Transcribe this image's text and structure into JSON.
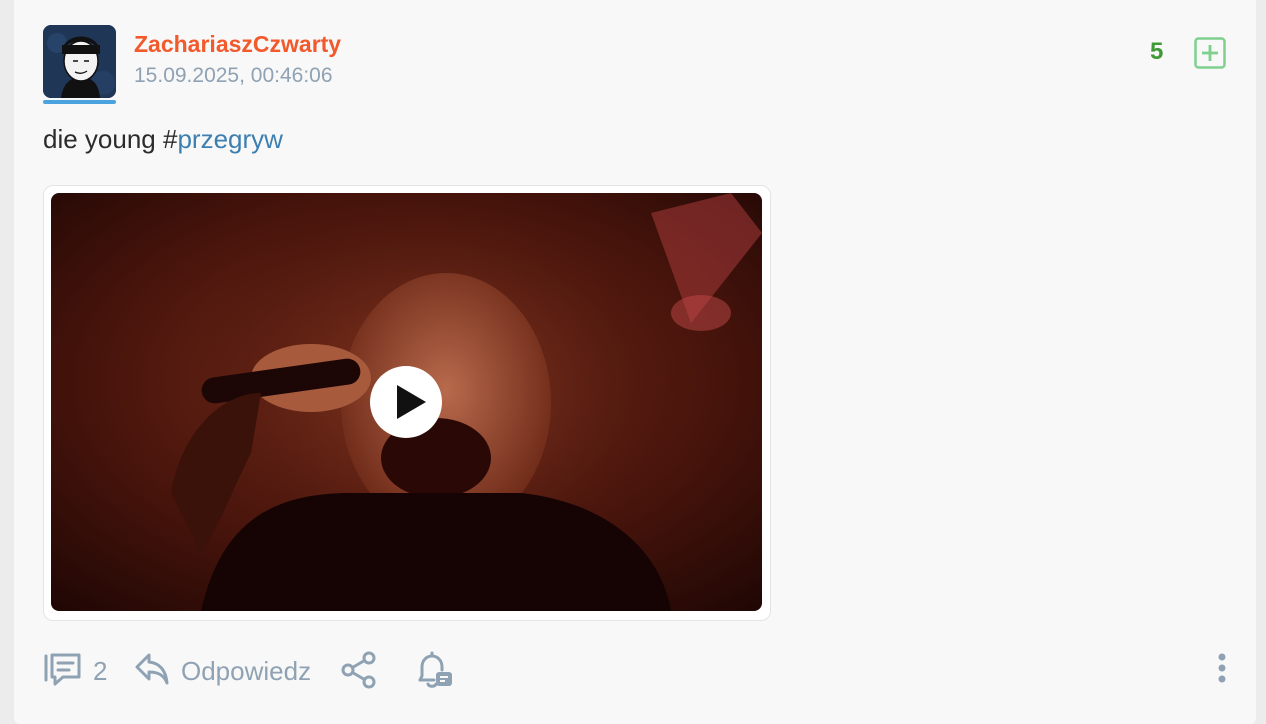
{
  "post": {
    "author": "ZachariaszCzwarty",
    "timestamp": "15.09.2025, 00:46:06",
    "score": "5",
    "text_prefix": "die young #",
    "hashtag": "przegryw"
  },
  "actions": {
    "comment_count": "2",
    "reply_label": "Odpowiedz"
  },
  "colors": {
    "author": "#f2592b",
    "score": "#3e9a34",
    "hashtag": "#3d7fb0",
    "muted": "#8fa2b4",
    "avatar_underline": "#4aa3df"
  },
  "icons": {
    "plus": "plus-square-icon",
    "comments": "comments-icon",
    "reply": "reply-icon",
    "share": "share-icon",
    "notify": "bell-icon",
    "more": "more-vertical-icon",
    "play": "play-icon"
  }
}
